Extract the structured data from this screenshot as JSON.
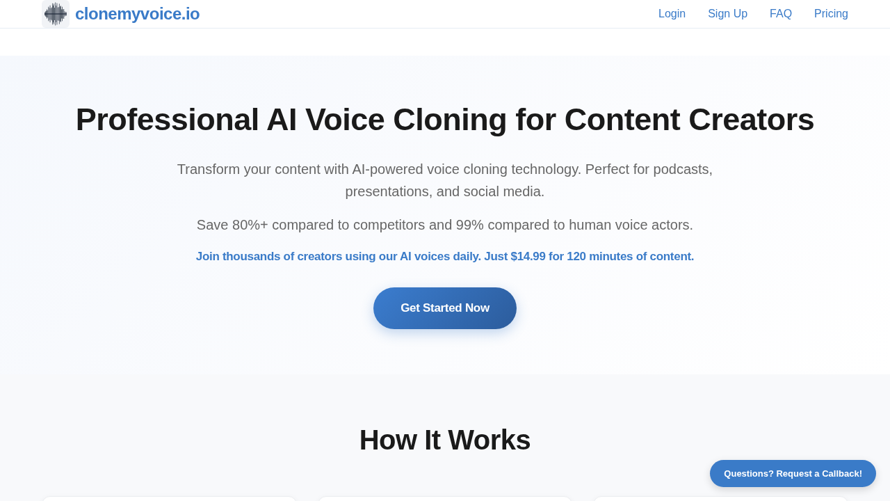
{
  "header": {
    "logo_text": "clonemyvoice.io",
    "nav": [
      "Login",
      "Sign Up",
      "FAQ",
      "Pricing"
    ]
  },
  "hero": {
    "title": "Professional AI Voice Cloning for Content Creators",
    "subtitle": "Transform your content with AI-powered voice cloning technology. Perfect for podcasts, presentations, and social media.",
    "savings": "Save 80%+ compared to competitors and 99% compared to human voice actors.",
    "highlight": "Join thousands of creators using our AI voices daily. Just $14.99 for 120 minutes of content.",
    "cta": "Get Started Now"
  },
  "how_it_works": {
    "title": "How It Works"
  },
  "callback_button": "Questions? Request a Callback!"
}
